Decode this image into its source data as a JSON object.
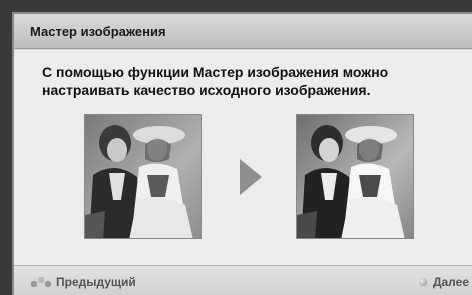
{
  "dialog": {
    "title": "Мастер изображения",
    "description": "С помощью функции Мастер изображения можно настраивать качество исходного изображения."
  },
  "images": {
    "before_icon": "portrait-before-image",
    "arrow_icon": "arrow-right-icon",
    "after_icon": "portrait-after-image"
  },
  "footer": {
    "prev_label": "Предыдущий",
    "prev_icon": "remote-button-icon",
    "next_label": "Далее",
    "next_icon": "ok-dot-icon"
  }
}
